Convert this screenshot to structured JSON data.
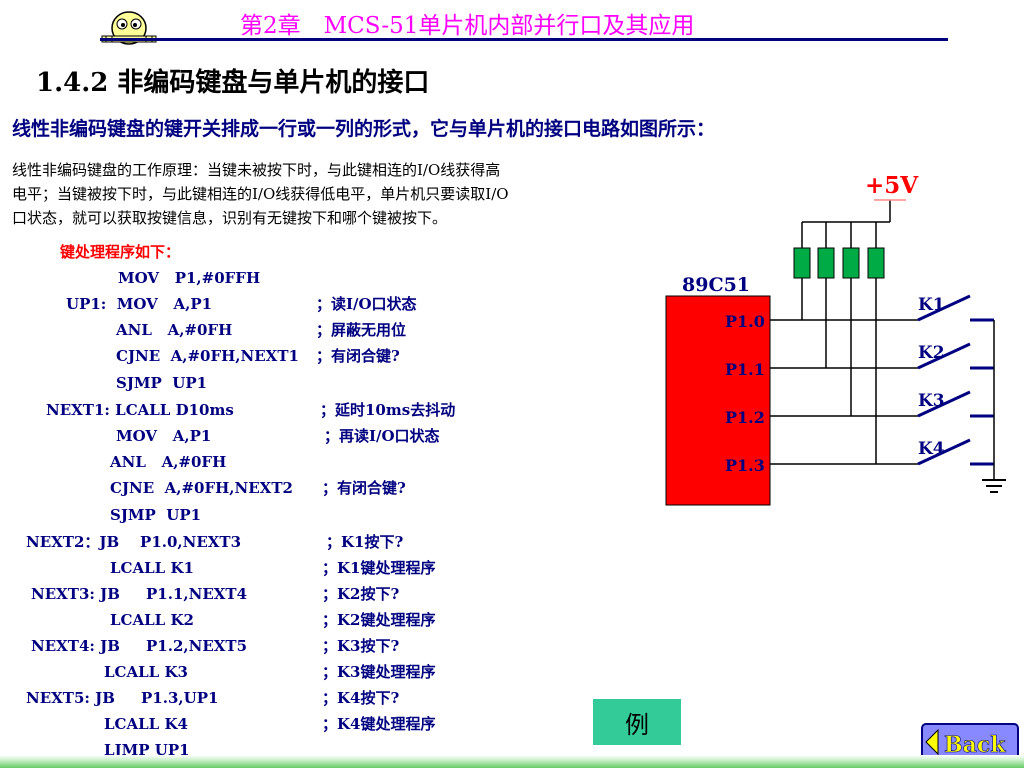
{
  "header": {
    "title": "第2章　MCS-51单片机内部并行口及其应用",
    "logo_icon": "cartoon-face-logo-icon"
  },
  "section": {
    "title": "1.4.2  非编码键盘与单片机的接口",
    "intro": "线性非编码键盘的键开关排成一行或一列的形式，它与单片机的接口电路如图所示："
  },
  "description": {
    "lines": [
      "线性非编码键盘的工作原理：当键未被按下时，与此键相连的I/O线获得高",
      "电平；当键被按下时，与此键相连的I/O线获得低电平，单片机只要读取I/O",
      "口状态，就可以获取按键信息，识别有无键按下和哪个键被按下。"
    ]
  },
  "code": {
    "title": "键处理程序如下：",
    "lines": [
      {
        "text": "MOV   P1,#0FFH",
        "comment": ""
      },
      {
        "text": "UP1:  MOV   A,P1",
        "comment": "；读I/O口状态"
      },
      {
        "text": "ANL   A,#0FH",
        "comment": "；屏蔽无用位"
      },
      {
        "text": "CJNE  A,#0FH,NEXT1",
        "comment": "；有闭合键?"
      },
      {
        "text": "SJMP  UP1",
        "comment": ""
      },
      {
        "text": "NEXT1: LCALL D10ms",
        "comment": "；延时10ms去抖动"
      },
      {
        "text": "MOV   A,P1",
        "comment": "；再读I/O口状态"
      },
      {
        "text": "ANL   A,#0FH",
        "comment": ""
      },
      {
        "text": "CJNE  A,#0FH,NEXT2",
        "comment": "；有闭合键?"
      },
      {
        "text": "SJMP  UP1",
        "comment": ""
      },
      {
        "text": "NEXT2：JB    P1.0,NEXT3",
        "comment": "；K1按下?"
      },
      {
        "text": "LCALL K1",
        "comment": "；K1键处理程序"
      },
      {
        "text": "NEXT3: JB     P1.1,NEXT4",
        "comment": "；K2按下?"
      },
      {
        "text": "LCALL K2",
        "comment": "；K2键处理程序"
      },
      {
        "text": "NEXT4: JB     P1.2,NEXT5",
        "comment": "；K3按下?"
      },
      {
        "text": "LCALL K3",
        "comment": "；K3键处理程序"
      },
      {
        "text": "NEXT5: JB     P1.3,UP1",
        "comment": "；K4按下?"
      },
      {
        "text": "LCALL K4",
        "comment": "；K4键处理程序"
      },
      {
        "text": "LJMP UP1",
        "comment": ""
      }
    ]
  },
  "circuit": {
    "supply": "+5V",
    "chip": "89C51",
    "pins": [
      "P1.0",
      "P1.1",
      "P1.2",
      "P1.3"
    ],
    "keys": [
      "K1",
      "K2",
      "K3",
      "K4"
    ],
    "colors": {
      "chip": "#ff0000",
      "resistor": "#00aa44",
      "label": "#000080",
      "supply": "#ff0000"
    }
  },
  "controls": {
    "example_label": "例",
    "back_label": "Back"
  }
}
